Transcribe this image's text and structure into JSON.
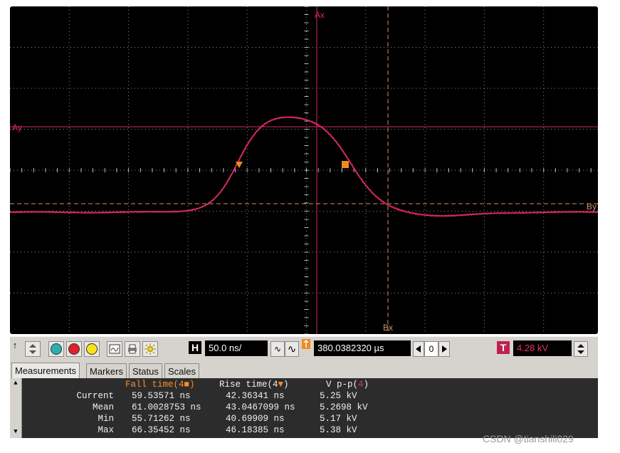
{
  "scope": {
    "cursor_labels": {
      "ax": "Ax",
      "ay": "Ay",
      "bx": "Bx",
      "by": "By"
    },
    "colors": {
      "trace": "#d8295f",
      "cursor_a": "#d8295f",
      "cursor_b": "#d4906a",
      "grid": "#9a9a9a",
      "marker_fall": "#f08a1c",
      "marker_rise": "#f08a1c"
    }
  },
  "toolbar": {
    "timebase": "50.0 ns/",
    "trigger_time": "380.0382320 µs",
    "offset_value": "0",
    "h_label": "H",
    "t_label": "T",
    "trigger_level": "4.28 kV",
    "wave_glyph_1": "∿",
    "wave_glyph_2": "∿",
    "marker_arrow": "↑"
  },
  "tabs": [
    {
      "label": "Measurements",
      "active": true
    },
    {
      "label": "Markers",
      "active": false
    },
    {
      "label": "Status",
      "active": false
    },
    {
      "label": "Scales",
      "active": false
    }
  ],
  "measurements": {
    "headers": {
      "fall": "Fall time(4",
      "fall_mark": "■",
      "fall_close": ")",
      "rise": "Rise time(4",
      "rise_mark": "▼",
      "rise_close": ")",
      "vpp": "V p-p(",
      "vpp_ch": "4",
      "vpp_close": ")"
    },
    "rows": [
      {
        "label": "Current",
        "fall": "59.53571 ns",
        "rise": "42.36341 ns",
        "vpp": "5.25 kV"
      },
      {
        "label": "Mean",
        "fall": "61.0028753 ns",
        "rise": "43.0467099 ns",
        "vpp": "5.2698 kV"
      },
      {
        "label": "Min",
        "fall": "55.71262 ns",
        "rise": "40.69909 ns",
        "vpp": "5.17 kV"
      },
      {
        "label": "Max",
        "fall": "66.35452 ns",
        "rise": "46.18385 ns",
        "vpp": "5.38 kV"
      }
    ]
  },
  "watermark": "CSDN @tianshili029"
}
